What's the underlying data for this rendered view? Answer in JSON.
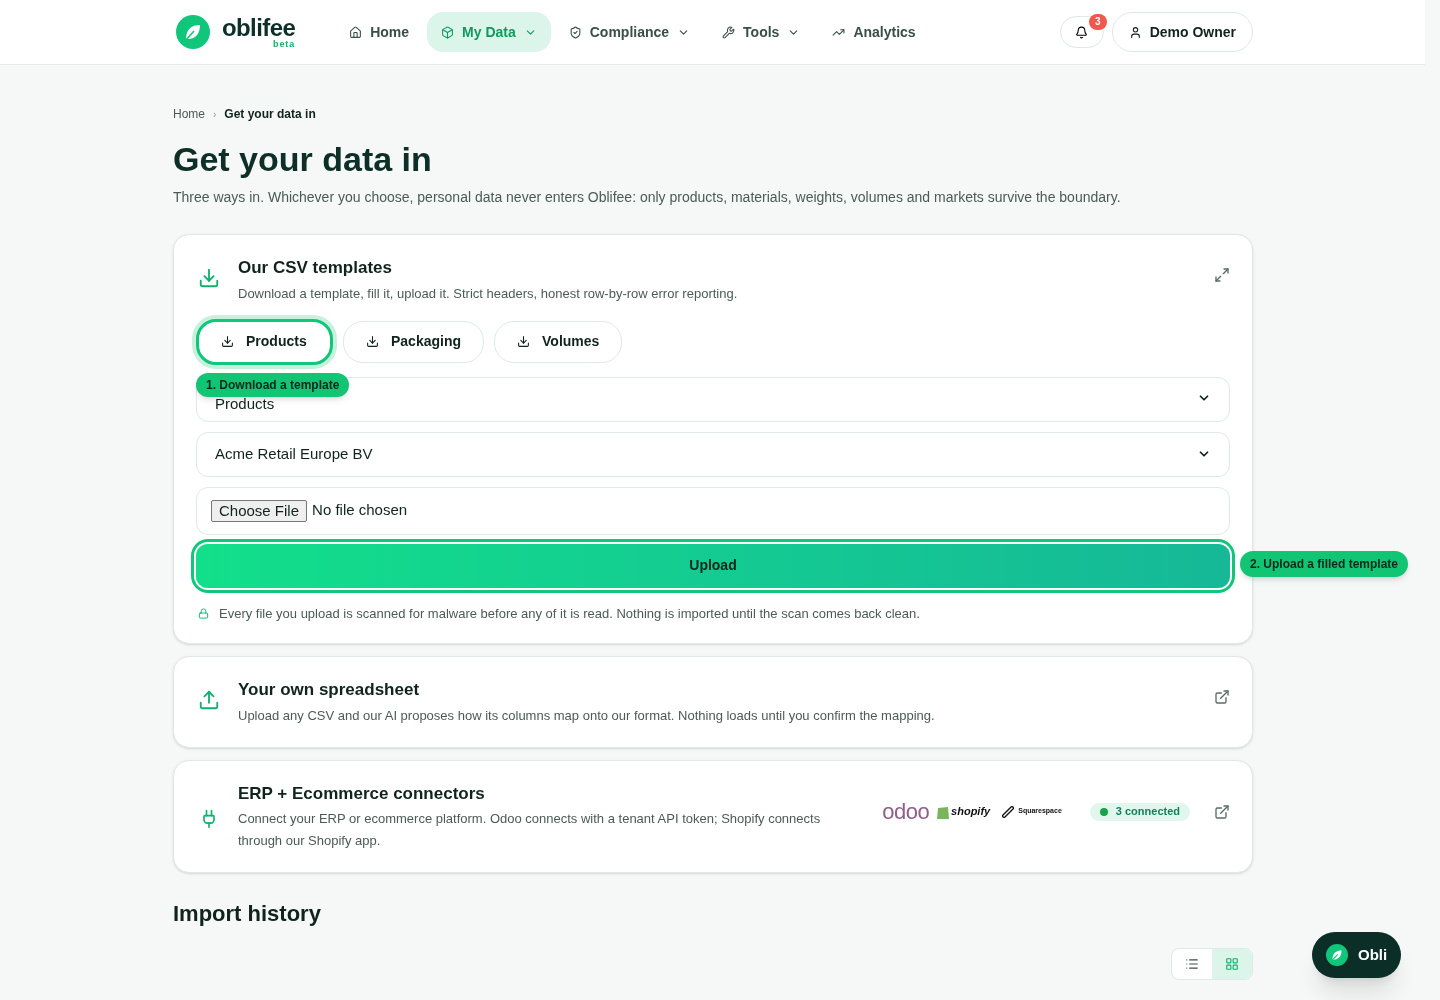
{
  "header": {
    "logo": {
      "wordmark": "oblifee",
      "tag": "beta"
    },
    "nav": [
      {
        "label": "Home",
        "dropdown": false,
        "selected": false
      },
      {
        "label": "My Data",
        "dropdown": true,
        "selected": true
      },
      {
        "label": "Compliance",
        "dropdown": true,
        "selected": false
      },
      {
        "label": "Tools",
        "dropdown": true,
        "selected": false
      },
      {
        "label": "Analytics",
        "dropdown": false,
        "selected": false
      }
    ],
    "notifications": {
      "count": "3"
    },
    "user": {
      "name": "Demo Owner"
    }
  },
  "breadcrumb": {
    "separator": "›",
    "items": [
      {
        "label": "Home"
      },
      {
        "label": "Get your data in"
      }
    ]
  },
  "title": "Get your data in",
  "intro": "Three ways in. Whichever you choose, personal data never enters Oblifee: only products, materials, weights, volumes and markets survive the boundary.",
  "csv_card": {
    "title": "Our CSV templates",
    "description": "Download a template, fill it, upload it. Strict headers, honest row-by-row error reporting.",
    "templates": [
      {
        "label": "Products",
        "highlighted": true
      },
      {
        "label": "Packaging",
        "highlighted": false
      },
      {
        "label": "Volumes",
        "highlighted": false
      }
    ],
    "step_1": "1. Download a template",
    "type_select": {
      "value": "Products"
    },
    "company_select": {
      "value": "Acme Retail Europe BV"
    },
    "file": {
      "button": "Choose File",
      "status": "No file chosen"
    },
    "upload": {
      "label": "Upload",
      "highlighted": true
    },
    "step_2": "2. Upload a filled template",
    "note": "Every file you upload is scanned for malware before any of it is read. Nothing is imported until the scan comes back clean."
  },
  "spreadsheet_card": {
    "title": "Your own spreadsheet",
    "description": "Upload any CSV and our AI proposes how its columns map onto our format. Nothing loads until you confirm the mapping."
  },
  "connectors_card": {
    "title": "ERP + Ecommerce connectors",
    "description": "Connect your ERP or ecommerce platform. Odoo connects with a tenant API token; Shopify connects through our Shopify app.",
    "logos": [
      {
        "kind": "odoo",
        "label": "odoo"
      },
      {
        "kind": "shopify",
        "label": "shopify"
      },
      {
        "kind": "squarespace",
        "label": "Squarespace"
      }
    ],
    "status": {
      "label": "3 connected",
      "color": "#16a34a"
    }
  },
  "import_history": {
    "title": "Import history",
    "views": [
      {
        "kind": "list",
        "selected": false
      },
      {
        "kind": "grid",
        "selected": true
      }
    ]
  },
  "assistant": {
    "label": "Obli"
  }
}
